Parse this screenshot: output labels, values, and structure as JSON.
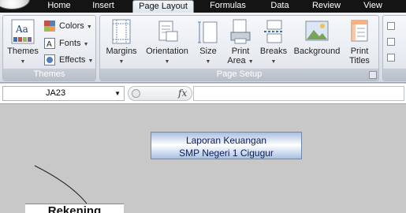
{
  "tabs": [
    "Home",
    "Insert",
    "Page Layout",
    "Formulas",
    "Data",
    "Review",
    "View"
  ],
  "ribbon": {
    "themes_group": {
      "label": "Themes",
      "themes_button": "Themes",
      "colors": "Colors",
      "fonts": "Fonts",
      "effects": "Effects"
    },
    "page_setup_group": {
      "label": "Page Setup",
      "margins": "Margins",
      "orientation": "Orientation",
      "size": "Size",
      "print_area_1": "Print",
      "print_area_2": "Area",
      "breaks": "Breaks",
      "background": "Background",
      "print_titles_1": "Print",
      "print_titles_2": "Titles"
    },
    "themes_icon_text": "Aa"
  },
  "formula_bar": {
    "name_box": "JA23",
    "fx": "fx",
    "formula": ""
  },
  "sheet": {
    "title_line1": "Laporan Keuangan",
    "title_line2": "SMP Negeri 1 Cigugur",
    "partial_box_text": "Rekening"
  }
}
